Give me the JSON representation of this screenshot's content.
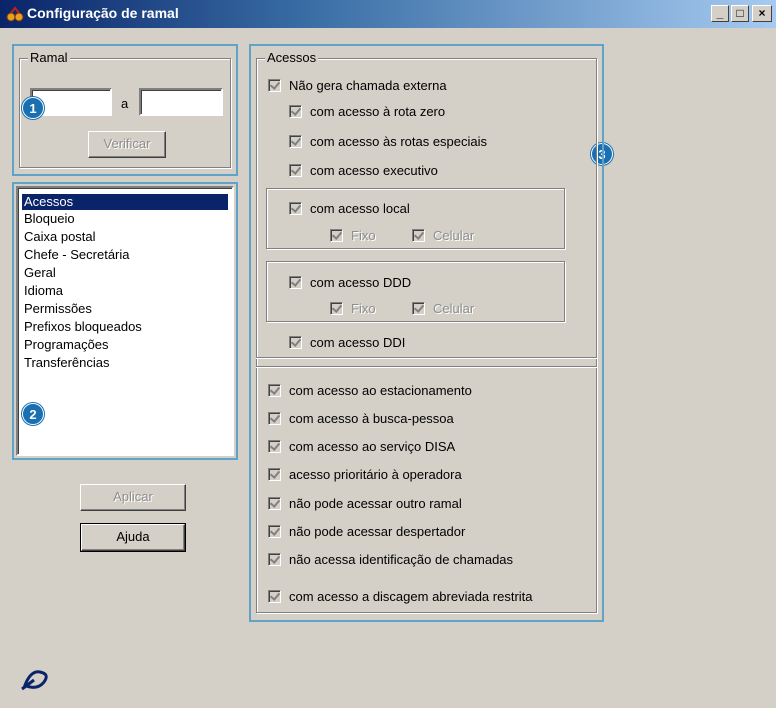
{
  "window": {
    "title": "Configuração de ramal",
    "minimize": "_",
    "maximize": "□",
    "close": "×"
  },
  "ramal": {
    "legend": "Ramal",
    "from_value": "",
    "separator": "a",
    "to_value": "",
    "verify_button": "Verificar"
  },
  "badges": [
    "1",
    "2",
    "3"
  ],
  "category_list": {
    "items": [
      "Acessos",
      "Bloqueio",
      "Caixa postal",
      "Chefe - Secretária",
      "Geral",
      "Idioma",
      "Permissões",
      "Prefixos bloqueados",
      "Programações",
      "Transferências"
    ],
    "selected": "Acessos"
  },
  "buttons": {
    "apply": "Aplicar",
    "help": "Ajuda"
  },
  "acessos": {
    "legend": "Acessos",
    "nao_gera": "Não gera chamada externa",
    "rota_zero": "com acesso à rota zero",
    "rotas_especiais": "com acesso às rotas especiais",
    "executivo": "com acesso executivo",
    "local": "com acesso local",
    "local_fixo": "Fixo",
    "local_celular": "Celular",
    "ddd": "com acesso DDD",
    "ddd_fixo": "Fixo",
    "ddd_celular": "Celular",
    "ddi": "com acesso DDI",
    "estacionamento": "com acesso ao estacionamento",
    "busca_pessoa": "com acesso à busca-pessoa",
    "disa": "com acesso ao serviço DISA",
    "prioritario": "acesso prioritário à operadora",
    "outro_ramal": "não pode acessar outro ramal",
    "despertador": "não pode acessar despertador",
    "identificacao": "não acessa identificação de chamadas",
    "discagem": "com acesso a discagem abreviada restrita"
  },
  "colors": {
    "title_start": "#0a246a",
    "title_end": "#a6caf0",
    "highlight_border": "#5fa3c8",
    "badge": "#1a6fb0",
    "selection": "#0a246a"
  }
}
